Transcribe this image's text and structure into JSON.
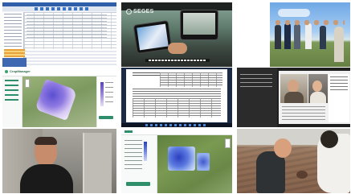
{
  "tiles": [
    {
      "label": "Spreadsheet software screenshot"
    },
    {
      "label": "Tablet and terminal in tractor cab",
      "brand": "SEGES"
    },
    {
      "label": "People standing in a field"
    },
    {
      "label": "CropManager map application",
      "app_title": "CropManager"
    },
    {
      "label": "Document with tables on desktop"
    },
    {
      "label": "Video call with two participants"
    },
    {
      "label": "Man speaking to camera outdoors"
    },
    {
      "label": "Field map application with side panel"
    },
    {
      "label": "Person examining soil in field"
    }
  ]
}
